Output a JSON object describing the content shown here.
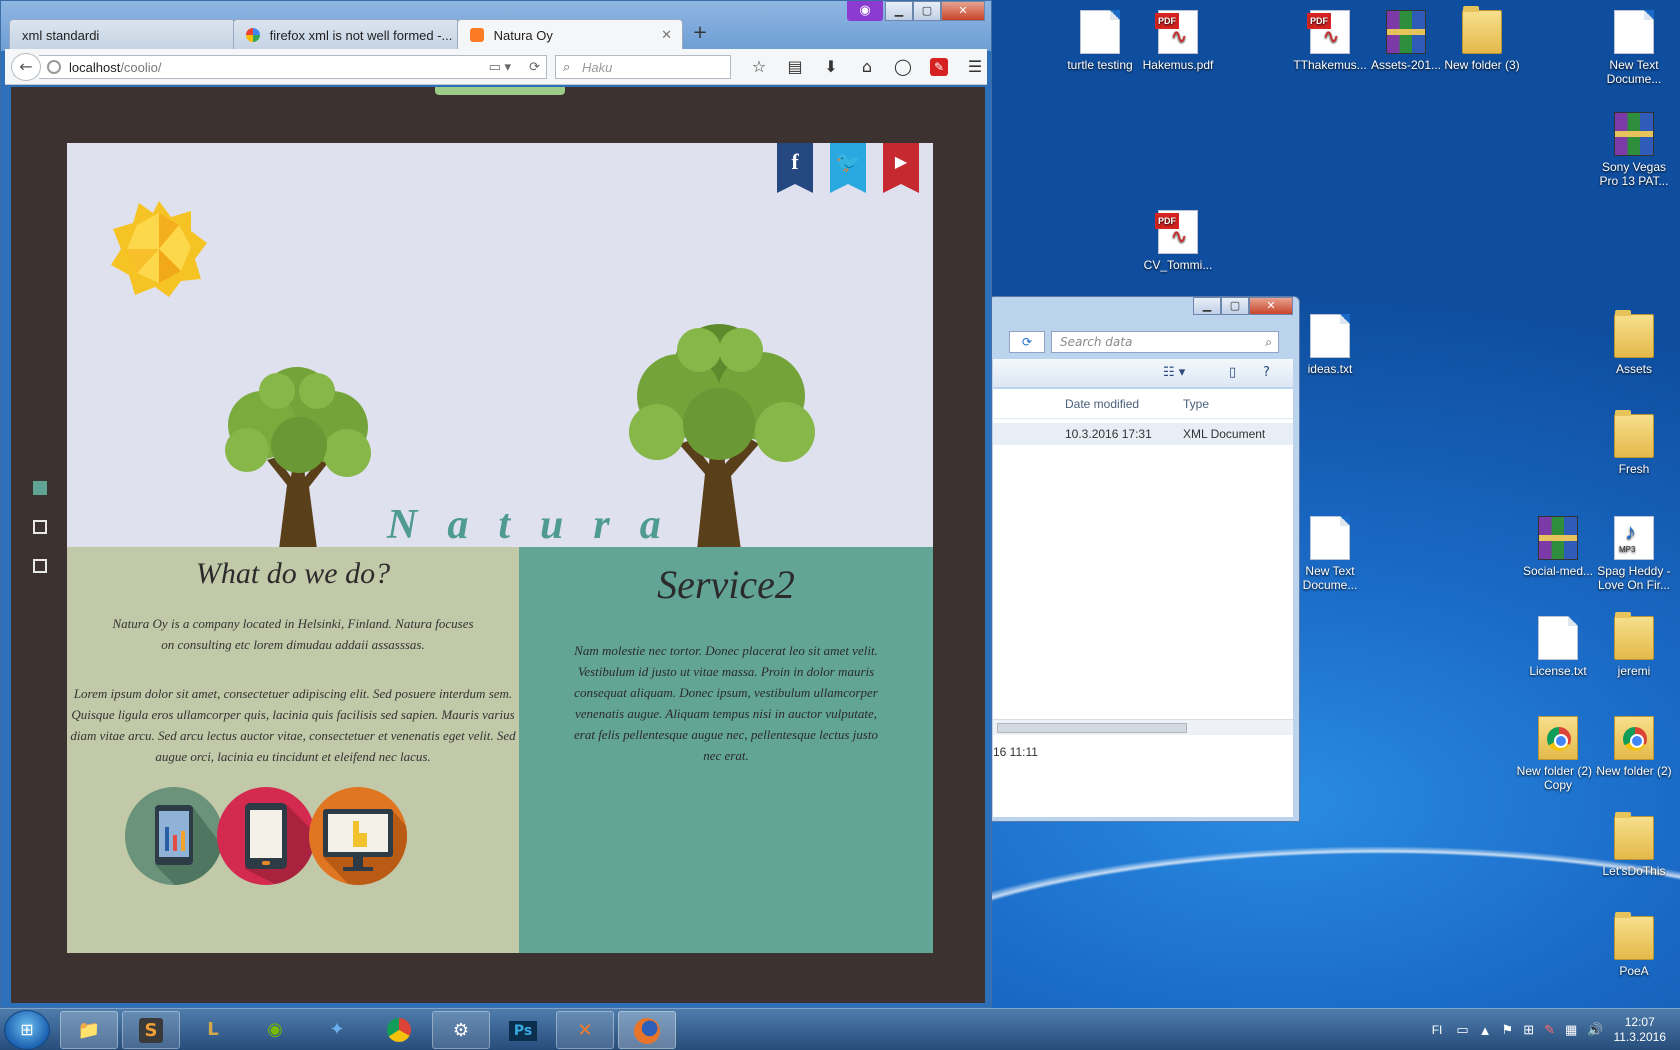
{
  "desktop": {
    "icons": [
      {
        "label": "turtle testing",
        "type": "file"
      },
      {
        "label": "Hakemus.pdf",
        "type": "pdf"
      },
      {
        "label": "TThakemus...",
        "type": "pdf"
      },
      {
        "label": "Assets-201...",
        "type": "rar"
      },
      {
        "label": "New folder (3)",
        "type": "folder"
      },
      {
        "label": "New Text Docume...",
        "type": "file"
      },
      {
        "label": "Sony Vegas Pro 13 PAT...",
        "type": "rar"
      },
      {
        "label": "CV_Tommi...",
        "type": "pdf"
      },
      {
        "label": "ideas.txt",
        "type": "file"
      },
      {
        "label": "Assets",
        "type": "folder"
      },
      {
        "label": "Fresh",
        "type": "folder"
      },
      {
        "label": "New Text Docume...",
        "type": "file"
      },
      {
        "label": "Social-med...",
        "type": "rar"
      },
      {
        "label": "Spag Heddy - Love On Fir...",
        "type": "mp3"
      },
      {
        "label": "License.txt",
        "type": "file"
      },
      {
        "label": "jeremi",
        "type": "folder"
      },
      {
        "label": "New folder (2) - Copy",
        "type": "chrome-folder"
      },
      {
        "label": "New folder (2)",
        "type": "chrome-folder"
      },
      {
        "label": "Let'sDoThis",
        "type": "folder"
      },
      {
        "label": "PoeA",
        "type": "folder"
      }
    ],
    "pdf_tag": "PDF",
    "mp3_tag": "MP3"
  },
  "explorer": {
    "search_placeholder": "Search data",
    "columns": {
      "date": "Date modified",
      "type": "Type"
    },
    "row": {
      "date": "10.3.2016 17:31",
      "type": "XML Document"
    },
    "status": "16 11:11",
    "scroll_marker": "III"
  },
  "browser": {
    "tabs": [
      {
        "label": "xml standardi"
      },
      {
        "label": "firefox xml is not well formed -..."
      },
      {
        "label": "Natura Oy"
      }
    ],
    "new_tab": "+",
    "url_host": "localhost",
    "url_path": "/coolio/",
    "search_placeholder": "Haku"
  },
  "site": {
    "brand": "Natura",
    "social": {
      "facebook": "f",
      "twitter": "🐦",
      "youtube": "▶"
    },
    "left": {
      "title": "What do we do?",
      "p1": "Natura Oy is a company located in Helsinki, Finland. Natura focuses on consulting etc lorem dimudau addaii assasssas.",
      "p2": "Lorem ipsum dolor sit amet, consectetuer adipiscing elit. Sed posuere interdum sem. Quisque ligula eros ullamcorper quis, lacinia quis facilisis sed sapien. Mauris varius diam vitae arcu. Sed arcu lectus auctor vitae, consectetuer et venenatis eget velit. Sed augue orci, lacinia eu tincidunt et eleifend nec lacus."
    },
    "right": {
      "title": "Service2",
      "p1": "Nam molestie nec tortor. Donec placerat leo sit amet velit. Vestibulum id justo ut vitae massa. Proin in dolor mauris consequat aliquam. Donec ipsum, vestibulum ullamcorper venenatis augue. Aliquam tempus nisi in auctor vulputate, erat felis pellentesque augue nec, pellentesque lectus justo nec erat."
    }
  },
  "taskbar": {
    "language": "FI",
    "time": "12:07",
    "date": "11.3.2016"
  }
}
